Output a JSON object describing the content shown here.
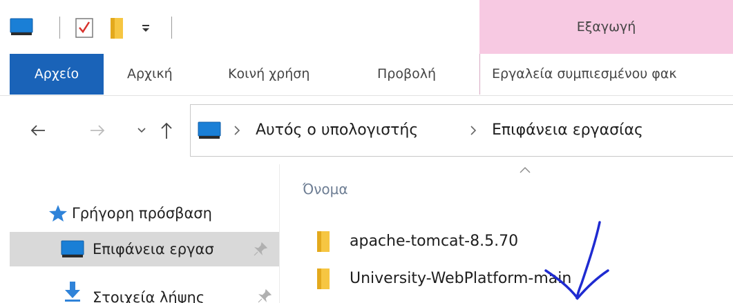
{
  "quick_access_toolbar": {
    "icons": [
      "computer-icon",
      "properties-check-icon",
      "new-folder-icon",
      "customize-toolbar-dropdown-icon"
    ]
  },
  "contextual_tab": {
    "label": "Εξαγωγή",
    "color": "#f7c9e2"
  },
  "ribbon": {
    "tabs": [
      {
        "label": "Αρχείο",
        "active": true
      },
      {
        "label": "Αρχική"
      },
      {
        "label": "Κοινή χρήση"
      },
      {
        "label": "Προβολή"
      },
      {
        "label": "Εργαλεία συμπιεσμένου φακ"
      }
    ],
    "accent": "#1a63b8"
  },
  "navigation": {
    "buttons": [
      "back-icon",
      "forward-icon",
      "recent-locations-icon",
      "up-icon"
    ]
  },
  "address_bar": {
    "icon": "computer-icon",
    "crumbs": [
      "Αυτός ο υπολογιστής",
      "Επιφάνεια εργασίας"
    ]
  },
  "nav_pane": {
    "items": [
      {
        "label": "Γρήγορη πρόσβαση",
        "icon": "star-icon"
      },
      {
        "label": "Επιφάνεια εργασ",
        "icon": "desktop-icon",
        "pinned": true,
        "selected": true
      },
      {
        "label": "Στοιχεία λήψης",
        "icon": "download-icon",
        "pinned": true
      }
    ]
  },
  "content": {
    "column_header": "Όνομα",
    "files": [
      {
        "name": "apache-tomcat-8.5.70",
        "icon": "folder-icon"
      },
      {
        "name": "University-WebPlatform-main",
        "icon": "folder-icon"
      }
    ]
  }
}
